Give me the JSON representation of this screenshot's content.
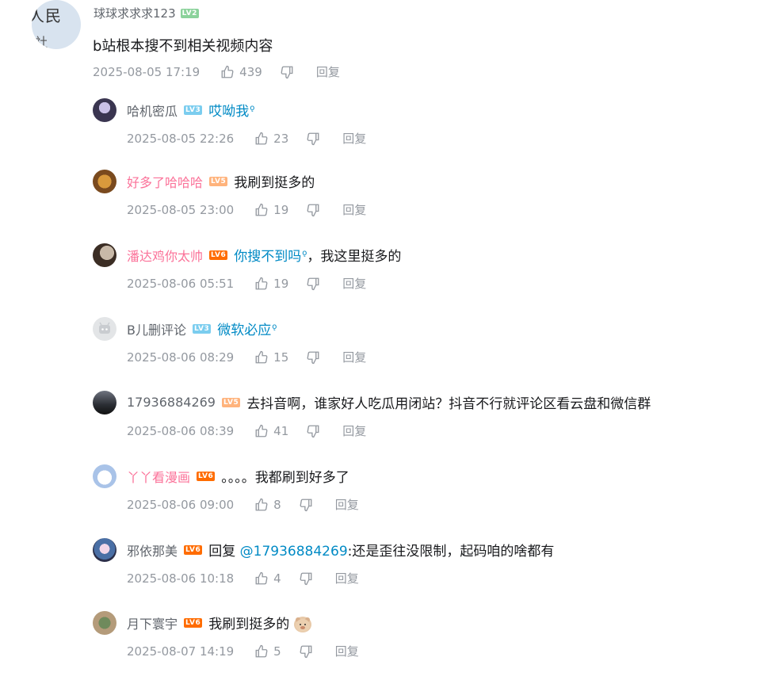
{
  "main_comment": {
    "avatar_text_line1": "人民",
    "avatar_text_line2": "社",
    "username": "球球求求求123",
    "level": "LV2",
    "content": "b站根本搜不到相关视频内容",
    "time": "2025-08-05 17:19",
    "likes": "439",
    "reply_label": "回复"
  },
  "replies": [
    {
      "username": "哈机密瓜",
      "level": "LV3",
      "keyword": "哎呦我",
      "text": "",
      "time": "2025-08-05 22:26",
      "likes": "23",
      "reply_label": "回复"
    },
    {
      "username": "好多了哈哈哈",
      "level": "LV5",
      "text": "我刷到挺多的",
      "time": "2025-08-05 23:00",
      "likes": "19",
      "reply_label": "回复"
    },
    {
      "username": "潘达鸡你太帅",
      "level": "LV6",
      "keyword": "你搜不到吗",
      "text": "，我这里挺多的",
      "time": "2025-08-06 05:51",
      "likes": "19",
      "reply_label": "回复"
    },
    {
      "username": "B儿删评论",
      "level": "LV3",
      "keyword": "微软必应",
      "text": "",
      "time": "2025-08-06 08:29",
      "likes": "15",
      "reply_label": "回复"
    },
    {
      "username": "17936884269",
      "level": "LV5",
      "text": "去抖音啊，谁家好人吃瓜用闭站？抖音不行就评论区看云盘和微信群",
      "time": "2025-08-06 08:39",
      "likes": "41",
      "reply_label": "回复"
    },
    {
      "username": "丫丫看漫画",
      "level": "LV6",
      "text": "。。。。我都刷到好多了",
      "time": "2025-08-06 09:00",
      "likes": "8",
      "reply_label": "回复"
    },
    {
      "username": "邪依那美",
      "level": "LV6",
      "prefix": "回复",
      "mention": "@17936884269",
      "text": ":还是歪往没限制，起码咱的啥都有",
      "time": "2025-08-06 10:18",
      "likes": "4",
      "reply_label": "回复"
    },
    {
      "username": "月下寰宇",
      "level": "LV6",
      "text": "我刷到挺多的",
      "time": "2025-08-07 14:19",
      "likes": "5",
      "reply_label": "回复"
    }
  ],
  "colors": {
    "lv2": "#8bd29b",
    "lv3": "#7bcdef",
    "lv5": "#ffb37c",
    "lv6": "#ff6c00",
    "accent_link": "#008ac5",
    "vip_name": "#fb7299",
    "meta": "#9499a0"
  }
}
